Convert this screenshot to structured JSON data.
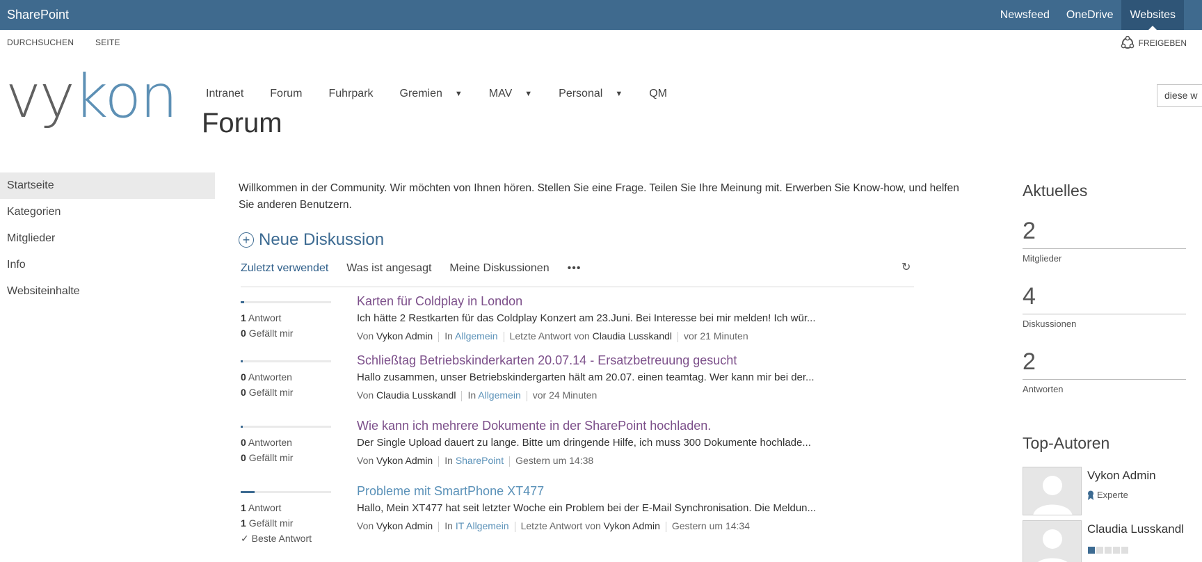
{
  "suitebar": {
    "brand": "SharePoint",
    "links": [
      "Newsfeed",
      "OneDrive",
      "Websites"
    ]
  },
  "ribbon": {
    "browse": "DURCHSUCHEN",
    "page": "SEITE",
    "share": "FREIGEBEN"
  },
  "logo": {
    "part1": "vy",
    "part2": "kon"
  },
  "topnav": [
    "Intranet",
    "Forum",
    "Fuhrpark",
    "Gremien",
    "MAV",
    "Personal",
    "QM"
  ],
  "page_title": "Forum",
  "search": {
    "value": "diese w"
  },
  "leftnav": [
    "Startseite",
    "Kategorien",
    "Mitglieder",
    "Info",
    "Websiteinhalte"
  ],
  "intro": "Willkommen in der Community. Wir möchten von Ihnen hören. Stellen Sie eine Frage. Teilen Sie Ihre Meinung mit. Erwerben Sie Know-how, und helfen Sie anderen Benutzern.",
  "new_discussion": "Neue Diskussion",
  "tabs": [
    "Zuletzt verwendet",
    "Was ist angesagt",
    "Meine Diskussionen",
    "•••"
  ],
  "discussions": [
    {
      "replies_count": "1",
      "replies_label": "Antwort",
      "likes_count": "0",
      "likes_label": "Gefällt mir",
      "best": "",
      "activity": 0.04,
      "title": "Karten für Coldplay in London",
      "excerpt": "Ich hätte 2 Restkarten für das Coldplay Konzert am 23.Juni. Bei Interesse bei mir melden! Ich wür...",
      "by_label": "Von",
      "author": "Vykon Admin",
      "in_label": "In",
      "category": "Allgemein",
      "last_label": "Letzte Antwort von",
      "last_author": "Claudia Lusskandl",
      "time": "vor 21 Minuten"
    },
    {
      "replies_count": "0",
      "replies_label": "Antworten",
      "likes_count": "0",
      "likes_label": "Gefällt mir",
      "best": "",
      "activity": 0.02,
      "title": "Schließtag Betriebskinderkarten 20.07.14 - Ersatzbetreuung gesucht",
      "excerpt": "Hallo zusammen, unser Betriebskindergarten hält am 20.07. einen teamtag. Wer kann mir bei der...",
      "by_label": "Von",
      "author": "Claudia Lusskandl",
      "in_label": "In",
      "category": "Allgemein",
      "last_label": "",
      "last_author": "",
      "time": "vor 24 Minuten"
    },
    {
      "replies_count": "0",
      "replies_label": "Antworten",
      "likes_count": "0",
      "likes_label": "Gefällt mir",
      "best": "",
      "activity": 0.02,
      "title": "Wie kann ich mehrere Dokumente in der SharePoint hochladen.",
      "excerpt": "Der Single Upload dauert zu lange. Bitte um dringende Hilfe, ich muss 300 Dokumente hochlade...",
      "by_label": "Von",
      "author": "Vykon Admin",
      "in_label": "In",
      "category": "SharePoint",
      "last_label": "",
      "last_author": "",
      "time": "Gestern um 14:38"
    },
    {
      "replies_count": "1",
      "replies_label": "Antwort",
      "likes_count": "1",
      "likes_label": "Gefällt mir",
      "best": "✓  Beste Antwort",
      "activity": 0.15,
      "title": "Probleme mit SmartPhone XT477",
      "excerpt": "Hallo, Mein XT477 hat seit letzter Woche ein Problem bei der E-Mail Synchronisation. Die Meldun...",
      "by_label": "Von",
      "author": "Vykon Admin",
      "in_label": "In",
      "category": "IT Allgemein",
      "last_label": "Letzte Antwort von",
      "last_author": "Vykon Admin",
      "time": "Gestern um 14:34"
    }
  ],
  "right": {
    "news_title": "Aktuelles",
    "stats": [
      {
        "value": "2",
        "label": "Mitglieder"
      },
      {
        "value": "4",
        "label": "Diskussionen"
      },
      {
        "value": "2",
        "label": "Antworten"
      }
    ],
    "top_title": "Top-Autoren",
    "authors": [
      {
        "name": "Vykon Admin",
        "badge": "Experte",
        "level": 0
      },
      {
        "name": "Claudia Lusskandl",
        "badge": "",
        "level": 1
      }
    ]
  },
  "colors": {
    "suitebar": "#3f6a8e",
    "accent": "#3d6b92",
    "visited_title": "#7c4f8a",
    "link": "#5a91b8"
  }
}
